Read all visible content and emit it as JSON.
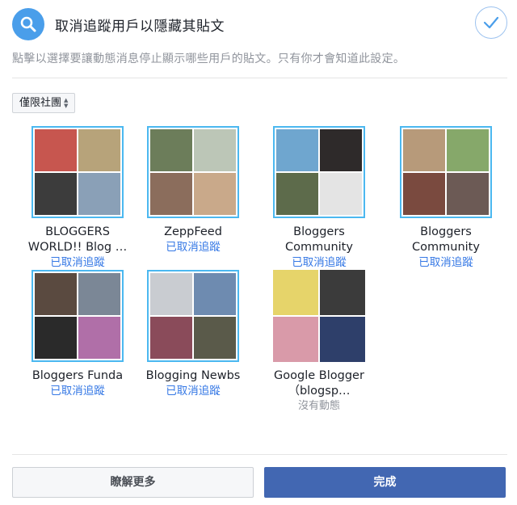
{
  "header": {
    "title": "取消追蹤用戶以隱藏其貼文",
    "description": "點擊以選擇要讓動態消息停止顯示哪些用戶的貼文。只有你才會知道此設定。"
  },
  "filter": {
    "label": "僅限社團"
  },
  "pages": [
    {
      "name": "BLOGGERS WORLD!! Blog …",
      "status": "已取消追蹤",
      "selected": true,
      "photos": [
        "#c7564f",
        "#b7a37a",
        "#3c3c3c",
        "#8aa0b7"
      ]
    },
    {
      "name": "ZeppFeed",
      "status": "已取消追蹤",
      "selected": true,
      "photos": [
        "#6c7d5a",
        "#bcc6b7",
        "#8b6d5c",
        "#c9a98a"
      ]
    },
    {
      "name": "Bloggers Community",
      "status": "已取消追蹤",
      "selected": true,
      "photos": [
        "#6fa6cf",
        "#2e2a2a",
        "#5d6b4b",
        "#e4e4e4"
      ]
    },
    {
      "name": "Bloggers Community",
      "status": "已取消追蹤",
      "selected": true,
      "photos": [
        "#b79a7a",
        "#86a86a",
        "#7a4a3f",
        "#6c5a55"
      ]
    },
    {
      "name": "Bloggers Funda",
      "status": "已取消追蹤",
      "selected": true,
      "photos": [
        "#5a4a40",
        "#7b8796",
        "#2a2a2a",
        "#b06fa8"
      ]
    },
    {
      "name": "Blogging Newbs",
      "status": "已取消追蹤",
      "selected": true,
      "photos": [
        "#c9ccd1",
        "#6e8bb0",
        "#8a4b5a",
        "#5a5a4a"
      ]
    },
    {
      "name": "Google Blogger（blogsp…",
      "status": "沒有動態",
      "selected": false,
      "photos": [
        "#e6d46a",
        "#3b3b3b",
        "#d99aa9",
        "#2e3f6a"
      ]
    }
  ],
  "buttons": {
    "learn_more": "瞭解更多",
    "done": "完成"
  },
  "colors": {
    "accent": "#4267b2",
    "link": "#3578e5",
    "selection_border": "#4bb8f0",
    "search_badge": "#4a9eea"
  },
  "icons": {
    "header_left": "search-icon",
    "header_right": "checkmark-icon",
    "filter_arrows": "sort-arrows-icon"
  }
}
